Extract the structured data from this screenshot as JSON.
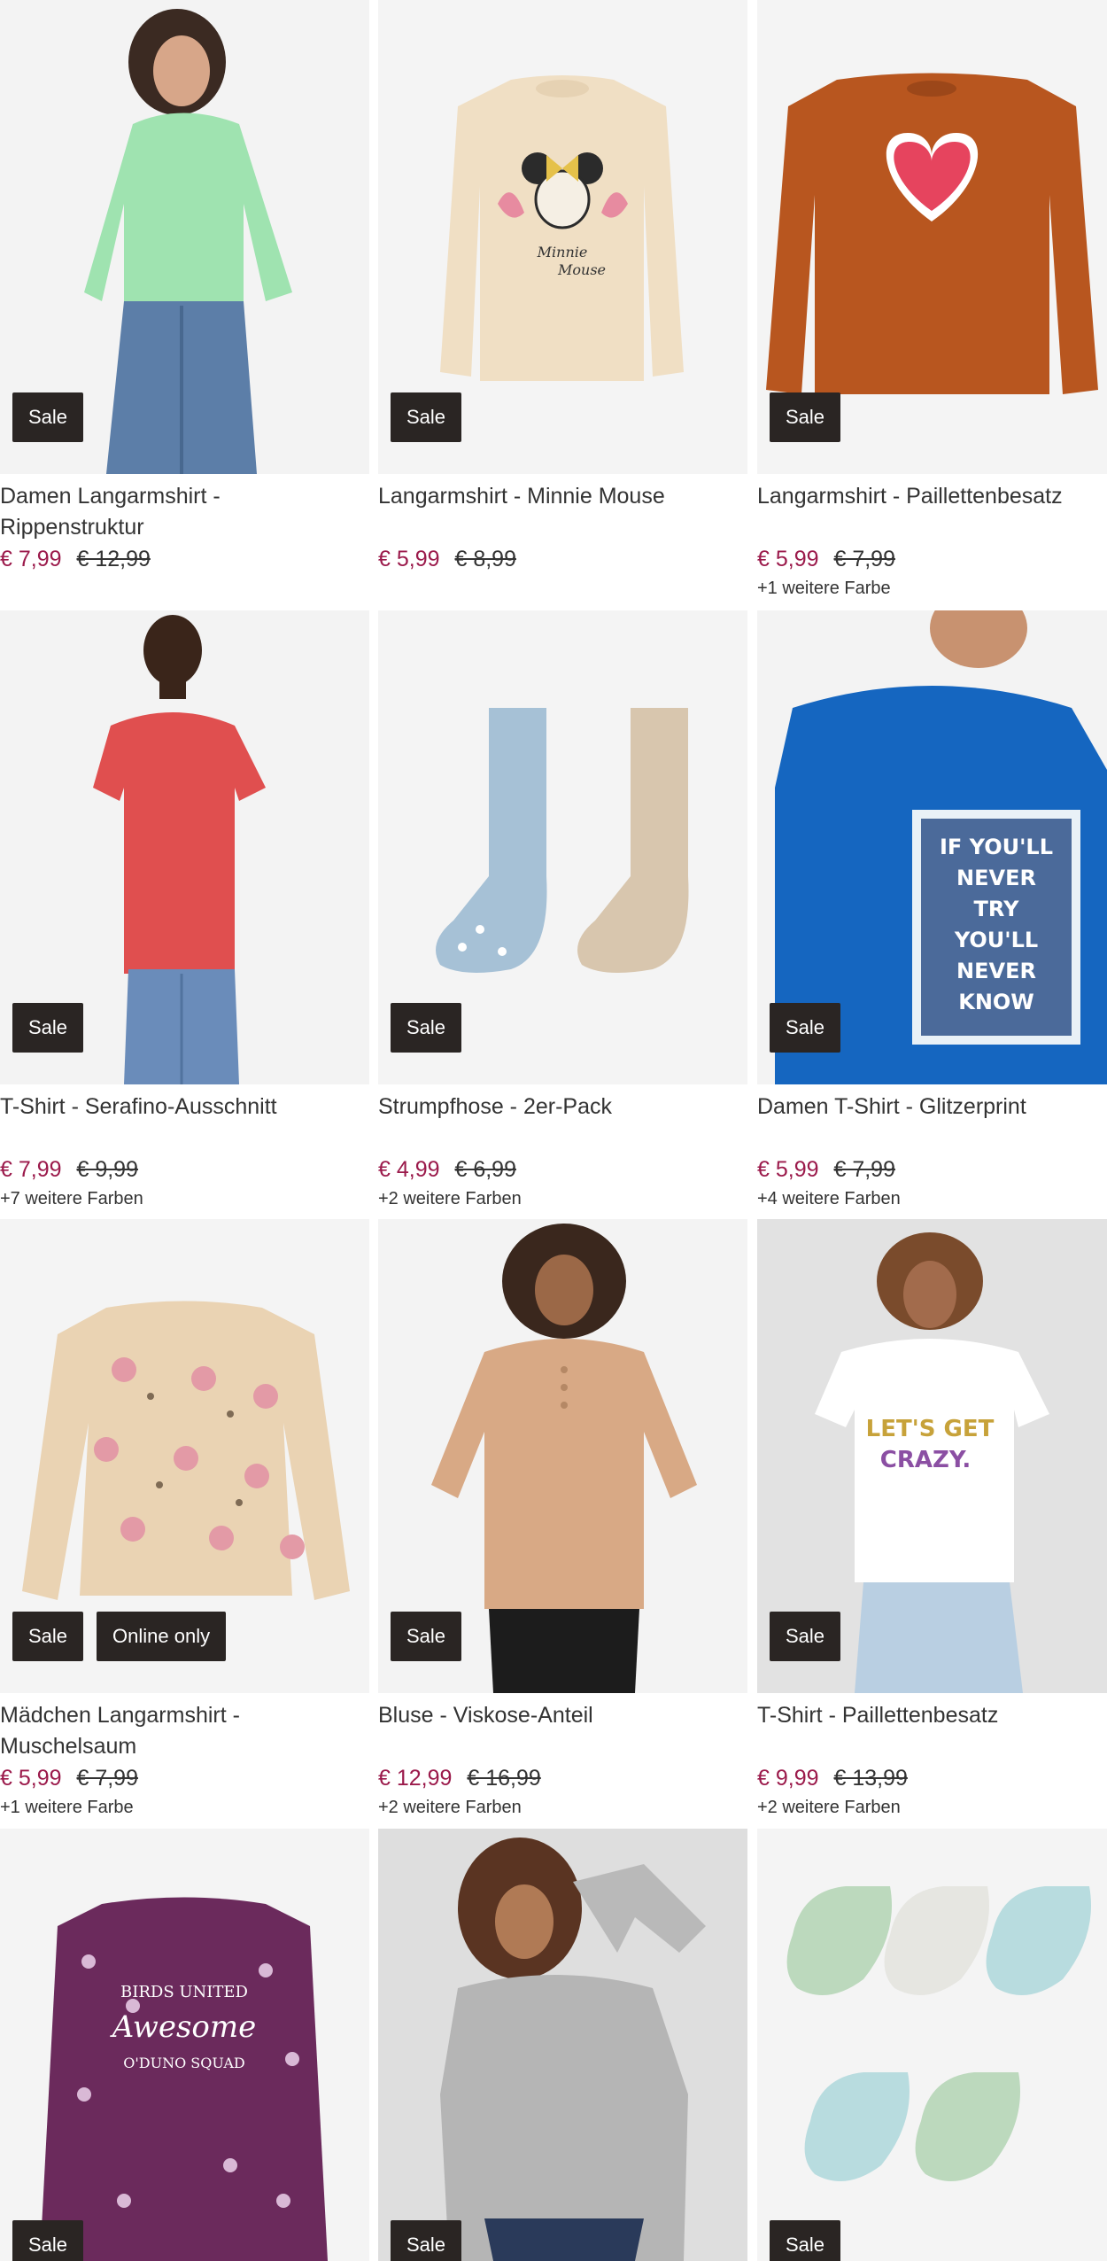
{
  "products": [
    {
      "title": "Damen Langarmshirt - Rippenstruktur",
      "price": "€ 7,99",
      "old_price": "€ 12,99",
      "colors_note": "",
      "badges": [
        "Sale"
      ],
      "icon": "green-longsleeve-model"
    },
    {
      "title": "Langarmshirt - Minnie Mouse",
      "price": "€ 5,99",
      "old_price": "€ 8,99",
      "colors_note": "",
      "badges": [
        "Sale"
      ],
      "icon": "minnie-mouse-longsleeve"
    },
    {
      "title": "Langarmshirt - Paillettenbesatz",
      "price": "€ 5,99",
      "old_price": "€ 7,99",
      "colors_note": "+1 weitere Farbe",
      "badges": [
        "Sale"
      ],
      "icon": "heart-longsleeve"
    },
    {
      "title": "T-Shirt - Serafino-Ausschnitt",
      "price": "€ 7,99",
      "old_price": "€ 9,99",
      "colors_note": "+7 weitere Farben",
      "badges": [
        "Sale"
      ],
      "icon": "red-tshirt-model"
    },
    {
      "title": "Strumpfhose - 2er-Pack",
      "price": "€ 4,99",
      "old_price": "€ 6,99",
      "colors_note": "+2 weitere Farben",
      "badges": [
        "Sale"
      ],
      "icon": "tights-pair"
    },
    {
      "title": "Damen T-Shirt - Glitzerprint",
      "price": "€ 5,99",
      "old_price": "€ 7,99",
      "colors_note": "+4 weitere Farben",
      "badges": [
        "Sale"
      ],
      "icon": "blue-tshirt-model"
    },
    {
      "title": "Mädchen Langarmshirt - Muschelsaum",
      "price": "€ 5,99",
      "old_price": "€ 7,99",
      "colors_note": "+1 weitere Farbe",
      "badges": [
        "Sale",
        "Online only"
      ],
      "icon": "unicorn-longsleeve"
    },
    {
      "title": "Bluse - Viskose-Anteil",
      "price": "€ 12,99",
      "old_price": "€ 16,99",
      "colors_note": "+2 weitere Farben",
      "badges": [
        "Sale"
      ],
      "icon": "beige-blouse-model"
    },
    {
      "title": "T-Shirt - Paillettenbesatz",
      "price": "€ 9,99",
      "old_price": "€ 13,99",
      "colors_note": "+2 weitere Farben",
      "badges": [
        "Sale"
      ],
      "icon": "white-tshirt-model"
    },
    {
      "title": "",
      "price": "",
      "old_price": "",
      "colors_note": "",
      "badges": [
        "Sale"
      ],
      "icon": "floral-purple-longsleeve"
    },
    {
      "title": "",
      "price": "",
      "old_price": "",
      "colors_note": "",
      "badges": [
        "Sale"
      ],
      "icon": "grey-sweater-model"
    },
    {
      "title": "",
      "price": "",
      "old_price": "",
      "colors_note": "",
      "badges": [
        "Sale"
      ],
      "icon": "socks-set"
    }
  ],
  "product_3_text": {
    "line1": "IF YOU'LL",
    "line2": "NEVER",
    "line3": "TRY",
    "line4": "YOU'LL",
    "line5": "NEVER",
    "line6": "KNOW"
  },
  "product_9_text": {
    "line1": "LET'S GET",
    "line2": "CRAZY."
  },
  "product_10_text": {
    "line1": "BIRDS UNITED",
    "line2": "Awesome",
    "line3": "O'DUNO SQUAD"
  },
  "product_2_text": {
    "line1": "Minnie",
    "line2": "Mouse"
  },
  "colors": {
    "sale_badge": "#2a2523",
    "price_now": "#9b1a4b"
  }
}
